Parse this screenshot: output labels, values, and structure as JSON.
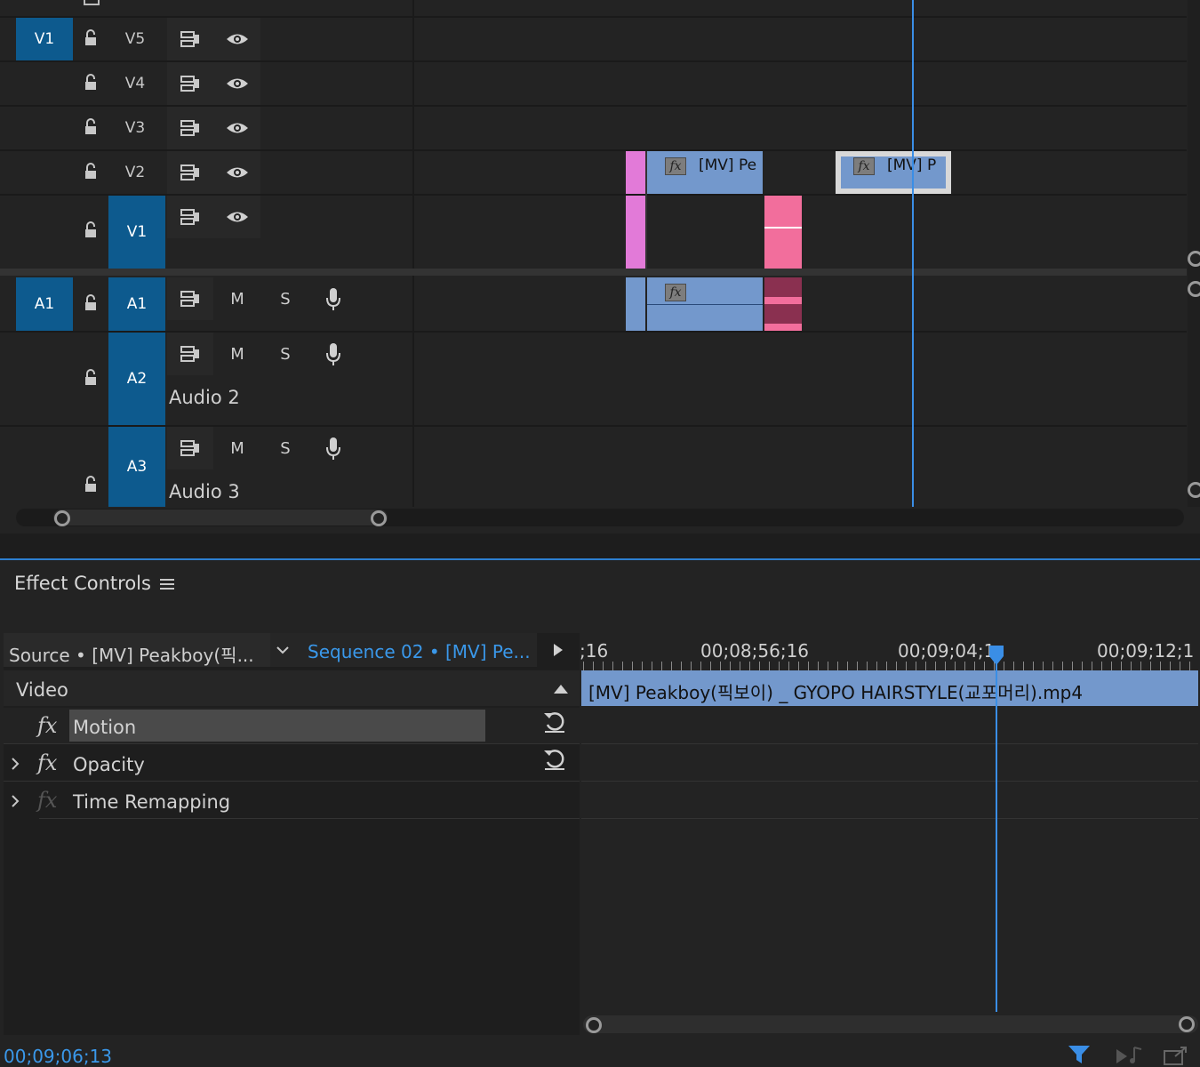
{
  "timeline": {
    "video_tracks": [
      {
        "target": "V1",
        "name": "V5",
        "eye": true
      },
      {
        "target": "",
        "name": "V4",
        "eye": true
      },
      {
        "target": "",
        "name": "V3",
        "eye": true
      },
      {
        "target": "",
        "name": "V2",
        "eye": true
      },
      {
        "target": "V1",
        "name": "",
        "eye": true
      }
    ],
    "audio_tracks": [
      {
        "source": "A1",
        "target": "A1",
        "label": "",
        "mute": "M",
        "solo": "S"
      },
      {
        "source": "",
        "target": "A2",
        "label": "Audio 2",
        "mute": "M",
        "solo": "S"
      },
      {
        "source": "",
        "target": "A3",
        "label": "Audio 3",
        "mute": "M",
        "solo": "S"
      }
    ],
    "clips": {
      "v2_clip1": "[MV] Pe",
      "v2_clip2": "[MV] P",
      "fx_badge": "fx"
    },
    "colors": {
      "track_target": "#0d5a8e",
      "clip_blue": "#7398cc",
      "clip_pink": "#f26e9c",
      "clip_violet": "#e27ad8",
      "playhead": "#3a8ee6"
    }
  },
  "effect_controls": {
    "panel_title": "Effect Controls",
    "source_label": "Source • [MV] Peakboy(픽...",
    "sequence_label": "Sequence 02 • [MV] Pe...",
    "timecodes": ";16",
    "ruler_labels": [
      "00;08;56;16",
      "00;09;04;1",
      "00;09;12;1"
    ],
    "ruler_left": ";16",
    "video_header": "Video",
    "effects": [
      {
        "name": "Motion",
        "expandable": false,
        "selected": true,
        "reset": true,
        "fx_dim": false
      },
      {
        "name": "Opacity",
        "expandable": true,
        "selected": false,
        "reset": true,
        "fx_dim": false
      },
      {
        "name": "Time Remapping",
        "expandable": true,
        "selected": false,
        "reset": false,
        "fx_dim": true
      }
    ],
    "clip_name": "[MV] Peakboy(픽보이) _ GYOPO HAIRSTYLE(교포머리).mp4",
    "current_time": "00;09;06;13"
  }
}
